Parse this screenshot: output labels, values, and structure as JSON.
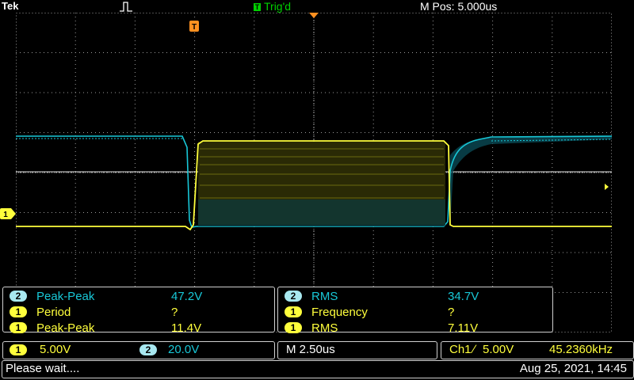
{
  "header": {
    "brand": "Tek",
    "trigger_state": "Trig'd",
    "trigger_icon": "T",
    "main_position": "M Pos: 5.000us"
  },
  "markers": {
    "trigger_marker": "T",
    "ch1_ground_marker": "1"
  },
  "measurements": {
    "left": [
      {
        "channel": "2",
        "name": "Peak-Peak",
        "value": "47.2V"
      },
      {
        "channel": "1",
        "name": "Period",
        "value": "?"
      },
      {
        "channel": "1",
        "name": "Peak-Peak",
        "value": "11.4V"
      }
    ],
    "right": [
      {
        "channel": "2",
        "name": "RMS",
        "value": "34.7V"
      },
      {
        "channel": "1",
        "name": "Frequency",
        "value": "?"
      },
      {
        "channel": "1",
        "name": "RMS",
        "value": "7.11V"
      }
    ]
  },
  "settings": {
    "ch1_badge": "1",
    "ch1_scale": "5.00V",
    "ch2_badge": "2",
    "ch2_scale": "20.0V",
    "timebase": "M 2.50us",
    "trigger_source": "Ch1",
    "trigger_slope": "∕",
    "trigger_level": "5.00V",
    "trigger_frequency": "45.2360kHz"
  },
  "status": {
    "message": "Please wait....",
    "datetime": "Aug 25, 2021, 14:45"
  },
  "colors": {
    "ch1": "#ffff3c",
    "ch2": "#18c8d8",
    "trigger": "#ff9020",
    "grid": "#a0a0a0"
  }
}
